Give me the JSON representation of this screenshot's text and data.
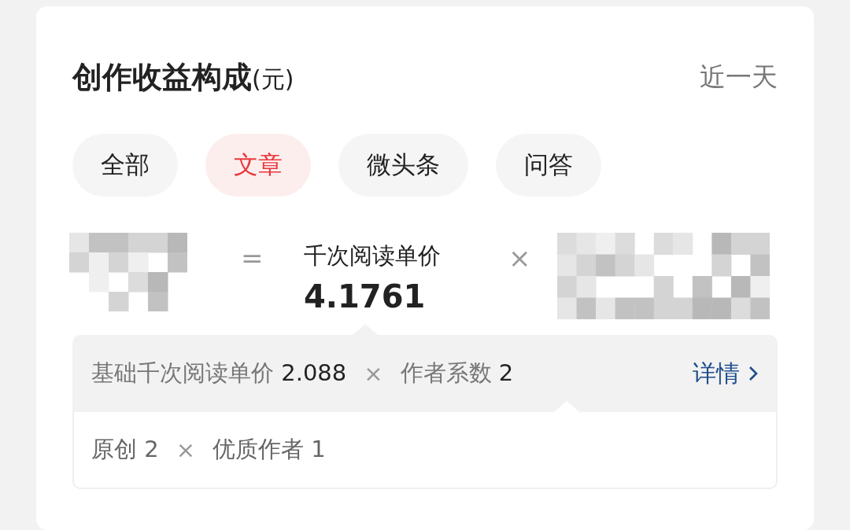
{
  "card": {
    "title": "创作收益构成",
    "title_unit": "(元)",
    "period": "近一天"
  },
  "tabs": [
    {
      "label": "全部",
      "selected": false
    },
    {
      "label": "文章",
      "selected": true
    },
    {
      "label": "微头条",
      "selected": false
    },
    {
      "label": "问答",
      "selected": false
    }
  ],
  "formula": {
    "equals": "=",
    "label": "千次阅读单价",
    "value": "4.1761",
    "times": "×"
  },
  "detail": {
    "factors": [
      "基础千次阅读单价 **2.088**",
      "作者系数 **2**"
    ],
    "operator": "×",
    "link": "详情",
    "sub_factors": [
      "原创 2",
      "优质作者 1"
    ],
    "sub_operator": "×"
  }
}
